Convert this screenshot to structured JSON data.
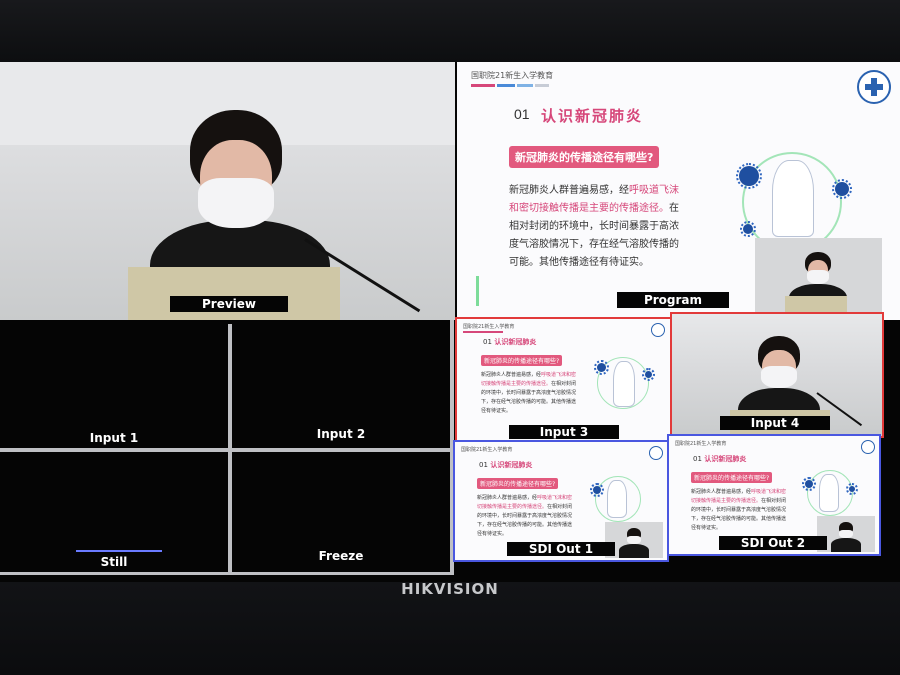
{
  "monitor": {
    "brand": "HIKVISION"
  },
  "preview": {
    "label": "Preview"
  },
  "program": {
    "label": "Program"
  },
  "inputs": [
    {
      "label": "Input 1"
    },
    {
      "label": "Input 2"
    },
    {
      "label": "Input 3"
    },
    {
      "label": "Input 4"
    }
  ],
  "utility": {
    "still_label": "Still",
    "freeze_label": "Freeze"
  },
  "outputs": [
    {
      "label": "SDI Out 1"
    },
    {
      "label": "SDI Out 2"
    }
  ],
  "slide": {
    "header": "国职院21新生入学教育",
    "section_number": "01",
    "section_title": "认识新冠肺炎",
    "question": "新冠肺炎的传播途径有哪些?",
    "para_1": "新冠肺炎人群普遍易感，经",
    "para_hl": "呼吸道飞沫和密切接触传播是主要的传播途径。",
    "para_2": "在相对封闭的环境中，长时间暴露于高浓度气溶胶情况下，存在经气溶胶传播的可能。其他传播途径有待证实。"
  },
  "colors": {
    "program_tally": "#e23a3a",
    "output_tally": "#4a57e0",
    "slide_accent": "#d6477a"
  }
}
